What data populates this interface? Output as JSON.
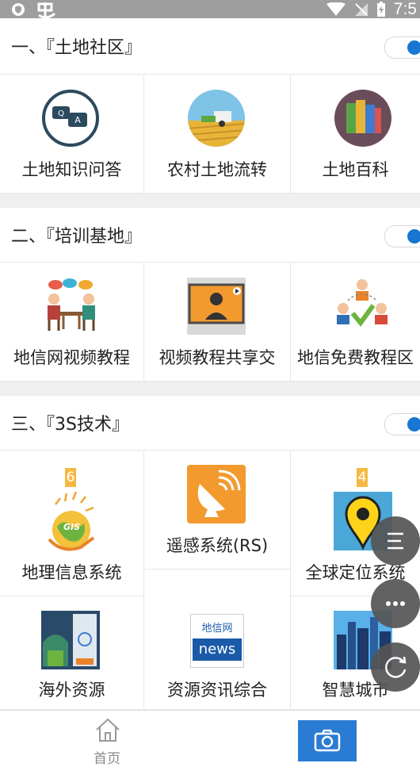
{
  "status_bar": {
    "time": "7:5"
  },
  "sections": [
    {
      "title": "一、『土地社区』",
      "items": [
        {
          "label": "土地知识问答",
          "icon": "qa-bubbles-icon"
        },
        {
          "label": "农村土地流转",
          "icon": "harvester-field-icon"
        },
        {
          "label": "土地百科",
          "icon": "books-icon"
        }
      ]
    },
    {
      "title": "二、『培训基地』",
      "items": [
        {
          "label": "地信网视频教程",
          "icon": "meeting-people-icon"
        },
        {
          "label": "视频教程共享交",
          "icon": "video-screen-icon"
        },
        {
          "label": "地信免费教程区",
          "icon": "team-check-icon"
        }
      ]
    },
    {
      "title": "三、『3S技术』",
      "items": [
        {
          "label": "地理信息系统",
          "icon": "gis-globe-icon",
          "badge": "6"
        },
        {
          "label": "遥感系统(RS)",
          "icon": "satellite-dish-icon"
        },
        {
          "label": "全球定位系统",
          "icon": "location-pin-icon",
          "badge": "4"
        },
        {
          "label": "海外资源",
          "icon": "overseas-building-icon"
        },
        {
          "label": "资源资讯综合",
          "icon": "news-logo-icon",
          "logo_top": "地信网",
          "logo_bottom": "news"
        },
        {
          "label": "智慧城市",
          "icon": "city-skyline-icon"
        }
      ]
    }
  ],
  "bottom_nav": {
    "home_label": "首页"
  },
  "colors": {
    "accent": "#1976d2",
    "camera_bg": "#2a7bd3",
    "badge": "#f5b942",
    "fab": "#555555"
  }
}
